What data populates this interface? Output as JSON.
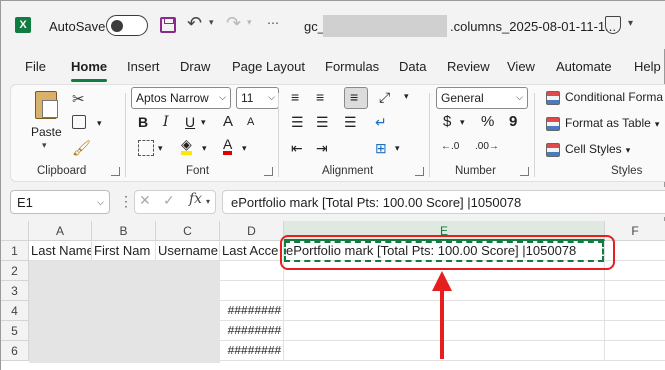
{
  "titlebar": {
    "logo": "X",
    "autosave_label": "AutoSave",
    "autosave_state": "Off",
    "filename_prefix": "gc_",
    "filename_suffix": ".columns_2025-08-01-11-1..."
  },
  "tabs": [
    "File",
    "Home",
    "Insert",
    "Draw",
    "Page Layout",
    "Formulas",
    "Data",
    "Review",
    "View",
    "Automate",
    "Help"
  ],
  "active_tab": "Home",
  "ribbon": {
    "clipboard": {
      "label": "Clipboard",
      "paste_label": "Paste"
    },
    "font": {
      "label": "Font",
      "font_name": "Aptos Narrow",
      "font_size": "11",
      "bold": "B",
      "italic": "I",
      "underline": "U",
      "grow": "A",
      "shrink": "A",
      "font_color_letter": "A"
    },
    "alignment": {
      "label": "Alignment"
    },
    "number": {
      "label": "Number",
      "format": "General",
      "currency": "$",
      "percent": "%",
      "comma": "9"
    },
    "styles": {
      "label": "Styles",
      "conditional": "Conditional Forma",
      "format_table": "Format as Table",
      "cell_styles": "Cell Styles"
    },
    "accent_color": "#107c41"
  },
  "formula_bar": {
    "name_box": "E1",
    "fx": "fx",
    "content": "ePortfolio mark [Total Pts: 100.00 Score] |1050078"
  },
  "grid": {
    "columns": [
      "A",
      "B",
      "C",
      "D",
      "E",
      "F"
    ],
    "rows": [
      "1",
      "2",
      "3",
      "4",
      "5",
      "6"
    ],
    "row1": [
      "Last Name",
      "First Nam",
      "Username",
      "Last Acce",
      "ePortfolio mark [Total Pts: 100.00 Score] |1050078",
      ""
    ],
    "d_values": [
      "########",
      "########",
      "########"
    ]
  },
  "annotation_color": "#e61e1e"
}
